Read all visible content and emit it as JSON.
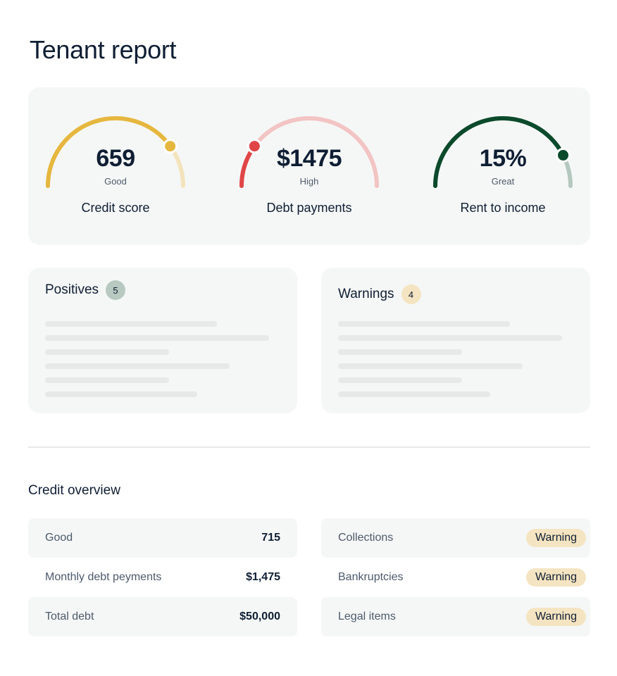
{
  "page": {
    "title": "Tenant report"
  },
  "gauges": [
    {
      "value": "659",
      "rating": "Good",
      "label": "Credit score",
      "level": 0.8,
      "colors": {
        "fill": "#e6b73e",
        "track": "#f3e3bc",
        "dot": "#e6b73e"
      }
    },
    {
      "value": "$1475",
      "rating": "High",
      "label": "Debt payments",
      "level": 0.2,
      "colors": {
        "fill": "#e04647",
        "track": "#f2c4c3",
        "dot": "#e04647"
      }
    },
    {
      "value": "15%",
      "rating": "Great",
      "label": "Rent to income",
      "level": 0.85,
      "colors": {
        "fill": "#0c4a2c",
        "track": "#b5c8c0",
        "dot": "#0c4a2c"
      }
    }
  ],
  "positives": {
    "title": "Positives",
    "count": "5",
    "badge_color": "#b7c9c1"
  },
  "warnings": {
    "title": "Warnings",
    "count": "4",
    "badge_color": "#f4e4c1"
  },
  "credit_overview": {
    "title": "Credit overview",
    "left_rows": [
      {
        "label": "Good",
        "value": "715"
      },
      {
        "label": "Monthly debt peyments",
        "value": "$1,475"
      },
      {
        "label": "Total debt",
        "value": "$50,000"
      }
    ],
    "right_rows": [
      {
        "label": "Collections",
        "status": "Warning"
      },
      {
        "label": "Bankruptcies",
        "status": "Warning"
      },
      {
        "label": "Legal items",
        "status": "Warning"
      }
    ]
  }
}
